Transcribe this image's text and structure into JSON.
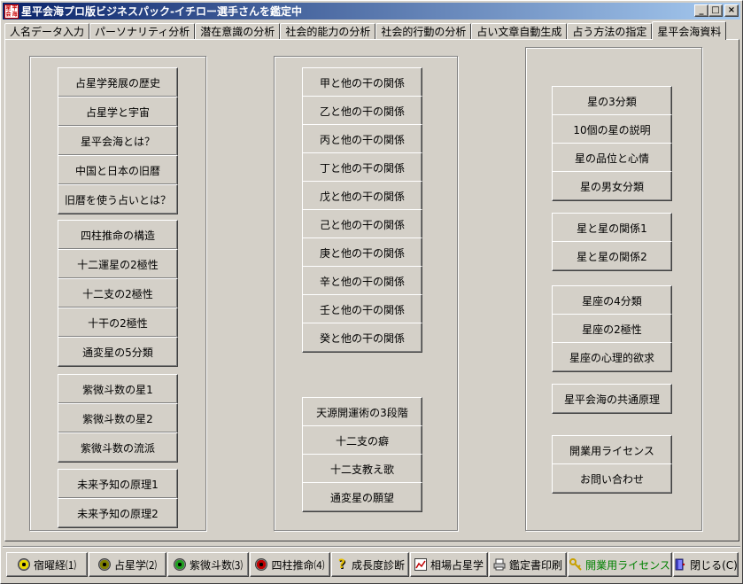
{
  "window": {
    "title": "星平会海プロ版ビジネスパック-イチロー選手さんを鑑定中",
    "icon_chars": [
      "星",
      "平",
      "会",
      "海"
    ],
    "controls": {
      "minimize": "_",
      "maximize": "□",
      "close": "×"
    }
  },
  "tabs": [
    {
      "label": "人名データ入力"
    },
    {
      "label": "パーソナリティ分析"
    },
    {
      "label": "潜在意識の分析"
    },
    {
      "label": "社会的能力の分析"
    },
    {
      "label": "社会的行動の分析"
    },
    {
      "label": "占い文章自動生成"
    },
    {
      "label": "占う方法の指定"
    },
    {
      "label": "星平会海資料"
    }
  ],
  "active_tab": "星平会海資料",
  "left_column": [
    {
      "label": "占星学発展の歴史"
    },
    {
      "label": "占星学と宇宙"
    },
    {
      "label": "星平会海とは？"
    },
    {
      "label": "中国と日本の旧暦"
    },
    {
      "label": "旧暦を使う占いとは？"
    },
    {
      "label": "四柱推命の構造"
    },
    {
      "label": "十二運星の2極性"
    },
    {
      "label": "十二支の2極性"
    },
    {
      "label": "十干の2極性"
    },
    {
      "label": "通変星の5分類"
    },
    {
      "label": "紫微斗数の星1"
    },
    {
      "label": "紫微斗数の星2"
    },
    {
      "label": "紫微斗数の流派"
    },
    {
      "label": "未来予知の原理1"
    },
    {
      "label": "未来予知の原理2"
    }
  ],
  "middle_column": [
    {
      "label": "甲と他の干の関係"
    },
    {
      "label": "乙と他の干の関係"
    },
    {
      "label": "丙と他の干の関係"
    },
    {
      "label": "丁と他の干の関係"
    },
    {
      "label": "戊と他の干の関係"
    },
    {
      "label": "己と他の干の関係"
    },
    {
      "label": "庚と他の干の関係"
    },
    {
      "label": "辛と他の干の関係"
    },
    {
      "label": "壬と他の干の関係"
    },
    {
      "label": "癸と他の干の関係"
    },
    {
      "label": "天源開運術の3段階"
    },
    {
      "label": "十二支の癖"
    },
    {
      "label": "十二支教え歌"
    },
    {
      "label": "通変星の願望"
    }
  ],
  "right_column": [
    {
      "label": "星の3分類"
    },
    {
      "label": "10個の星の説明"
    },
    {
      "label": "星の品位と心情"
    },
    {
      "label": "星の男女分類"
    },
    {
      "label": "星と星の関係1"
    },
    {
      "label": "星と星の関係2"
    },
    {
      "label": "星座の4分類"
    },
    {
      "label": "星座の2極性"
    },
    {
      "label": "星座の心理的欲求"
    },
    {
      "label": "星平会海の共通原理"
    },
    {
      "label": "開業用ライセンス"
    },
    {
      "label": "お問い合わせ"
    }
  ],
  "bottom_bar": [
    {
      "label": "宿曜経⑴",
      "icon": "yellow-target-icon",
      "color": "#e8d800"
    },
    {
      "label": "占星学⑵",
      "icon": "olive-target-icon",
      "color": "#808000"
    },
    {
      "label": "紫微斗数⑶",
      "icon": "green-target-icon",
      "color": "#20a020"
    },
    {
      "label": "四柱推命⑷",
      "icon": "red-target-icon",
      "color": "#c00000"
    },
    {
      "label": "成長度診断",
      "icon": "question-icon",
      "color": "#e8c000"
    },
    {
      "label": "相場占星学",
      "icon": "chart-icon",
      "color": "#c00000"
    },
    {
      "label": "鑑定書印刷",
      "icon": "printer-icon",
      "color": "#404040"
    },
    {
      "label": "開業用ライセンス",
      "icon": "key-icon",
      "color": "#c8a000"
    },
    {
      "label": "閉じる(C)",
      "icon": "exit-door-icon",
      "color": "#4040c0"
    }
  ]
}
